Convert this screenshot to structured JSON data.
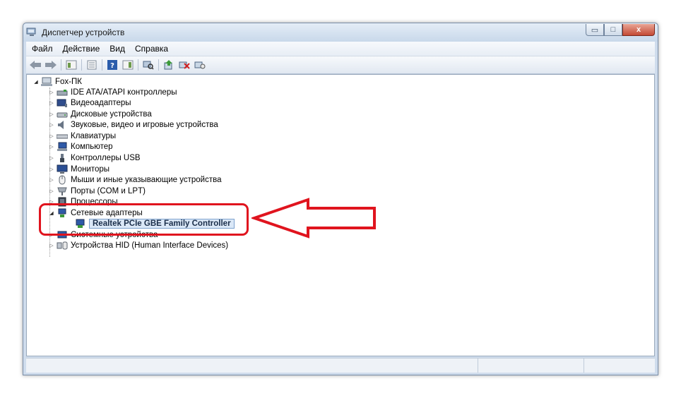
{
  "window": {
    "title": "Диспетчер устройств",
    "controls": {
      "minimize": "▭",
      "maximize": "□",
      "close": "x"
    }
  },
  "menu": {
    "items": [
      "Файл",
      "Действие",
      "Вид",
      "Справка"
    ]
  },
  "toolbar": {
    "buttons": [
      "back-icon",
      "forward-icon",
      "console-tree-icon",
      "properties-icon",
      "help-icon",
      "action-pane-icon",
      "scan-hardware-icon",
      "update-driver-icon",
      "disable-device-icon",
      "uninstall-device-icon"
    ]
  },
  "tree": {
    "root": "Fox-ПК",
    "categories": [
      "IDE ATA/ATAPI контроллеры",
      "Видеоадаптеры",
      "Дисковые устройства",
      "Звуковые, видео и игровые устройства",
      "Клавиатуры",
      "Компьютер",
      "Контроллеры USB",
      "Мониторы",
      "Мыши и иные указывающие устройства",
      "Порты (COM и LPT)",
      "Процессоры",
      "Сетевые адаптеры",
      "Системные устройства",
      "Устройства HID (Human Interface Devices)"
    ],
    "expanded_category": "Сетевые адаптеры",
    "selected_device": "Realtek PCIe GBE Family Controller"
  },
  "colors": {
    "annotation_red": "#e0141e",
    "selection_bg": "#dbe8f7"
  }
}
